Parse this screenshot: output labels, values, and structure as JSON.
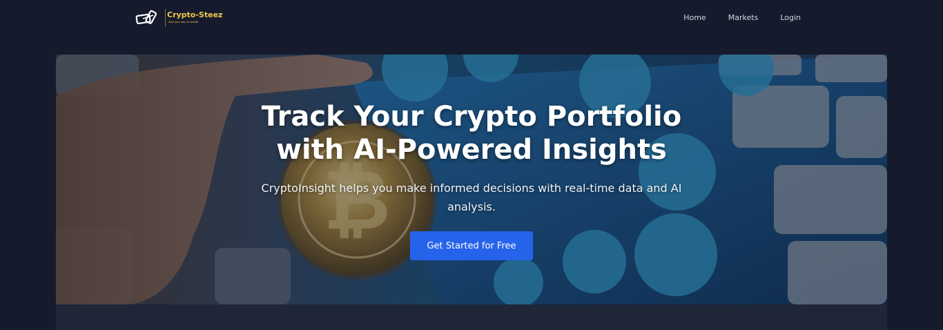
{
  "brand": {
    "name": "Crypto-Steez",
    "tagline": "lead your way to wealth",
    "logo_icon": "chain-link-icon",
    "accent_color": "#f2c84b"
  },
  "nav": {
    "items": [
      {
        "label": "Home"
      },
      {
        "label": "Markets"
      },
      {
        "label": "Login"
      }
    ]
  },
  "hero": {
    "title_line1": "Track Your Crypto Portfolio",
    "title_line2": "with AI-Powered Insights",
    "subtitle": "CryptoInsight helps you make informed decisions with real-time data and AI analysis.",
    "cta_label": "Get Started for Free",
    "cta_color": "#2563eb",
    "background_image": "hand-holding-bitcoin-over-keyboard-photo"
  },
  "colors": {
    "page_background": "#151b2c",
    "section_background": "#1e2638"
  }
}
